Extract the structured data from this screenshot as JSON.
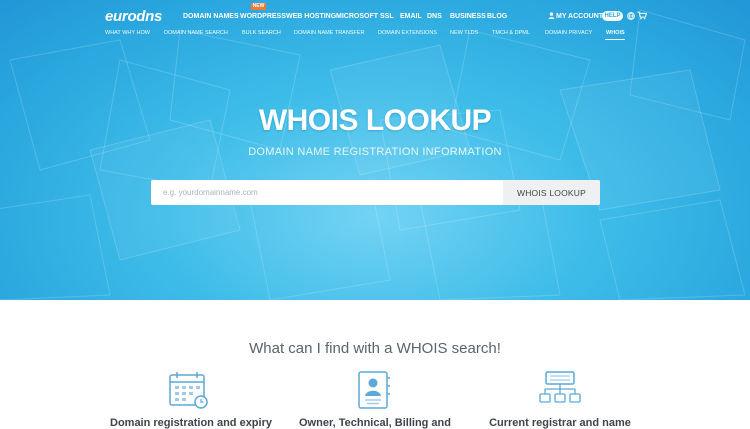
{
  "header": {
    "logo": "eurodns",
    "nav": [
      "DOMAIN NAMES",
      "WORDPRESS",
      "WEB HOSTING",
      "MICROSOFT",
      "SSL",
      "EMAIL",
      "DNS",
      "BUSINESS",
      "BLOG"
    ],
    "new_badge": "NEW",
    "account_label": "MY ACCOUNT",
    "help_label": "HELP",
    "subnav": [
      "WHAT WHY HOW",
      "DOMAIN NAME SEARCH",
      "BULK SEARCH",
      "DOMAIN NAME TRANSFER",
      "DOMAIN EXTENSIONS",
      "NEW TLDS",
      "TMCH & DPML",
      "DOMAIN PRIVACY",
      "WHOIS"
    ],
    "active_subnav": "WHOIS"
  },
  "hero": {
    "title": "WHOIS LOOKUP",
    "subtitle": "DOMAIN NAME REGISTRATION INFORMATION",
    "search_placeholder": "e.g. yourdomainname.com",
    "search_value": "",
    "search_button": "WHOIS LOOKUP"
  },
  "features": {
    "heading": "What can I find with a WHOIS search!",
    "items": [
      {
        "icon": "calendar-icon",
        "label": "Domain registration and expiry"
      },
      {
        "icon": "contact-card-icon",
        "label": "Owner, Technical, Billing and"
      },
      {
        "icon": "network-hierarchy-icon",
        "label": "Current registrar and name"
      }
    ]
  },
  "colors": {
    "hero_blue": "#2aa8df",
    "accent_orange": "#f07a3a",
    "icon_blue": "#5aa9d9"
  }
}
